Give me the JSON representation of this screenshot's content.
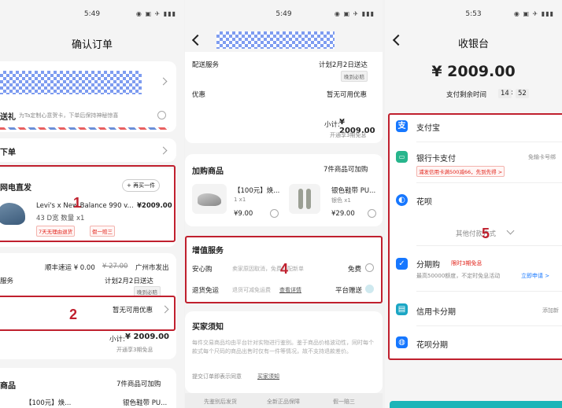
{
  "screens": {
    "p1": {
      "time": "5:49",
      "title": "确认订单",
      "gift_label": "送礼",
      "gift_desc": "为Ta定制心意贺卡，下单后保持神秘惊喜",
      "order_label": "下单",
      "store_name": "网电直发",
      "add_item_btn": "+ 再买一件",
      "product_name": "Levi's x New Balance 990 v...",
      "product_price": "¥2009.00",
      "product_spec": "43 D宽  数量 x1",
      "tag_return": "7天无理由退货",
      "tag_fake": "假一赔三",
      "shipping_line": "顺丰速运  ¥ 0.00",
      "shipping_strike": "¥ 27.00",
      "shipping_from": "广州市发出",
      "service_label": "服务",
      "service_value": "计划2月2日送达",
      "service_pill": "晚到必赔",
      "discount_value": "暂无可用优惠",
      "subtotal_label": "小计:",
      "subtotal_value": "¥ 2009.00",
      "installment": "开通享3期免息",
      "addon_label": "商品",
      "addon_right": "7件商品可加购",
      "addon_item1": "【100元】焕...",
      "addon_item2": "银色鞋带 PU...",
      "anno_1": "1",
      "anno_2": "2"
    },
    "p2": {
      "time": "5:49",
      "delivery_label": "配送服务",
      "delivery_value": "计划2月2日送达",
      "delivery_pill": "晚到必赔",
      "discount_label": "优惠",
      "discount_value": "暂无可用优惠",
      "subtotal_label": "小计:",
      "subtotal_value": "¥ 2009.00",
      "installment": "开通享3期免息",
      "addon_title": "加购商品",
      "addon_right": "7件商品可加购",
      "addon1_name": "【100元】焕...",
      "addon1_spec": "1  x1",
      "addon1_price": "¥9.00",
      "addon2_name": "银色鞋带 PU...",
      "addon2_spec": "银色  x1",
      "addon2_price": "¥29.00",
      "vas_title": "增值服务",
      "vas1_label": "安心购",
      "vas1_desc": "卖家原因取消，免费匹配新单",
      "vas1_value": "免费",
      "vas2_label": "退货免运",
      "vas2_desc": "退货可减免运费",
      "vas2_link": "查看详情",
      "vas2_value": "平台赠送",
      "notice_title": "买家须知",
      "notice_body": "每件交易商品均由平台针对实物进行鉴别。鉴于商品价格波动性，同时每个款式每个尺码的商品出售时仅有一件等情况，故不支持退款差价。",
      "notice_footer": "提交订单即表示同意",
      "notice_link": "买家须知",
      "footer1": "先鉴别后发货",
      "footer2": "全新正品保障",
      "footer3": "假一赔三",
      "anno_4": "4"
    },
    "p3": {
      "time": "5:53",
      "title": "收银台",
      "amount": "¥ 2009.00",
      "remain_label": "支付剩余时间",
      "remain_min": "14",
      "remain_sec": "52",
      "alipay": "支付宝",
      "bank": "银行卡支付",
      "bank_right": "免输卡号绑",
      "bank_promo": "浦发信用卡满500减66，先到先得 >",
      "huabei": "花呗",
      "other": "其他付款方式",
      "fenqi": "分期购",
      "fenqi_badge": "限时3期免息",
      "fenqi_desc": "最高50000额度，不定时免息活动",
      "fenqi_link": "立即申请 >",
      "credit": "信用卡分期",
      "credit_right": "添加新",
      "huabei_fq": "花呗分期",
      "anno_5": "5"
    }
  }
}
